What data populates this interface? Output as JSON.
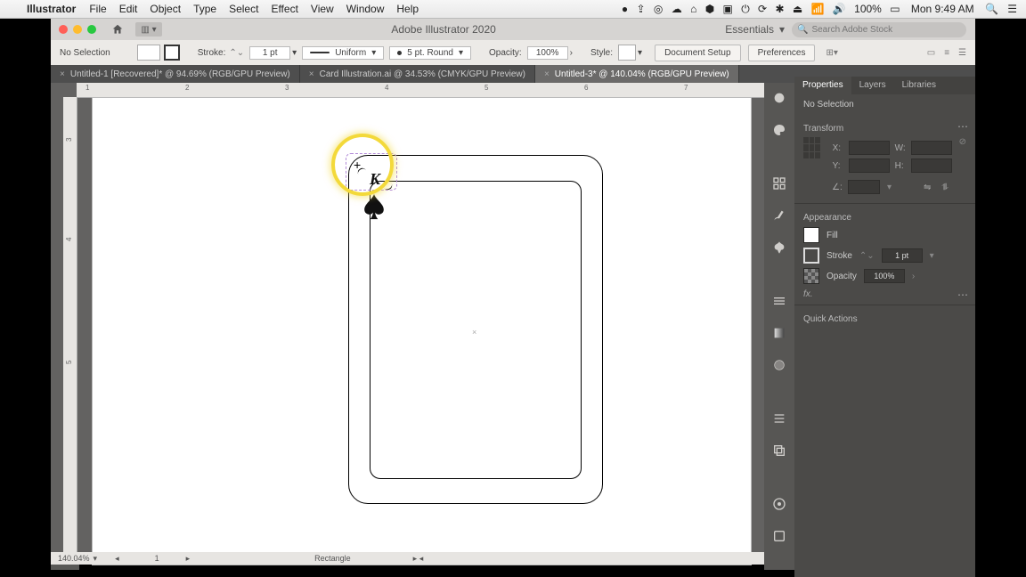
{
  "menubar": {
    "app": "Illustrator",
    "items": [
      "File",
      "Edit",
      "Object",
      "Type",
      "Select",
      "Effect",
      "View",
      "Window",
      "Help"
    ],
    "right": [
      "●",
      "⇪",
      "◎",
      "☁",
      "⌂",
      "⬢",
      "▣",
      "⏻",
      "⟳",
      "✱",
      "⏏",
      "📶",
      "🔊"
    ],
    "battery": "100%",
    "battery_icon": "▭",
    "clock": "Mon 9:49 AM",
    "search_icon": "🔍",
    "menu_icon": "☰"
  },
  "titlebar": {
    "title": "Adobe Illustrator 2020",
    "essentials": "Essentials",
    "search_placeholder": "Search Adobe Stock"
  },
  "control": {
    "selection": "No Selection",
    "stroke_label": "Stroke:",
    "stroke_val": "1 pt",
    "stroke_style": "Uniform",
    "brush": "5 pt. Round",
    "opacity_label": "Opacity:",
    "opacity_val": "100%",
    "style_label": "Style:",
    "btn1": "Document Setup",
    "btn2": "Preferences"
  },
  "tabs": [
    {
      "label": "Untitled-1 [Recovered]* @ 94.69% (RGB/GPU Preview)",
      "active": false
    },
    {
      "label": "Card Illustration.ai @ 34.53% (CMYK/GPU Preview)",
      "active": false
    },
    {
      "label": "Untitled-3* @ 140.04% (RGB/GPU Preview)",
      "active": true
    }
  ],
  "ruler_h": [
    "1",
    "2",
    "3",
    "4",
    "5",
    "6",
    "7"
  ],
  "ruler_v": [
    "3",
    "4",
    "5"
  ],
  "canvas": {
    "king": "K"
  },
  "status": {
    "zoom": "140.04%",
    "page": "1",
    "shape": "Rectangle"
  },
  "props": {
    "tabs": [
      "Properties",
      "Layers",
      "Libraries"
    ],
    "sel": "No Selection",
    "transform": "Transform",
    "x": "X:",
    "y": "Y:",
    "w": "W:",
    "h": "H:",
    "angle": "∠:",
    "appearance": "Appearance",
    "fill": "Fill",
    "stroke": "Stroke",
    "stroke_val": "1 pt",
    "opacity": "Opacity",
    "opacity_val": "100%",
    "fx": "fx.",
    "quick": "Quick Actions"
  }
}
